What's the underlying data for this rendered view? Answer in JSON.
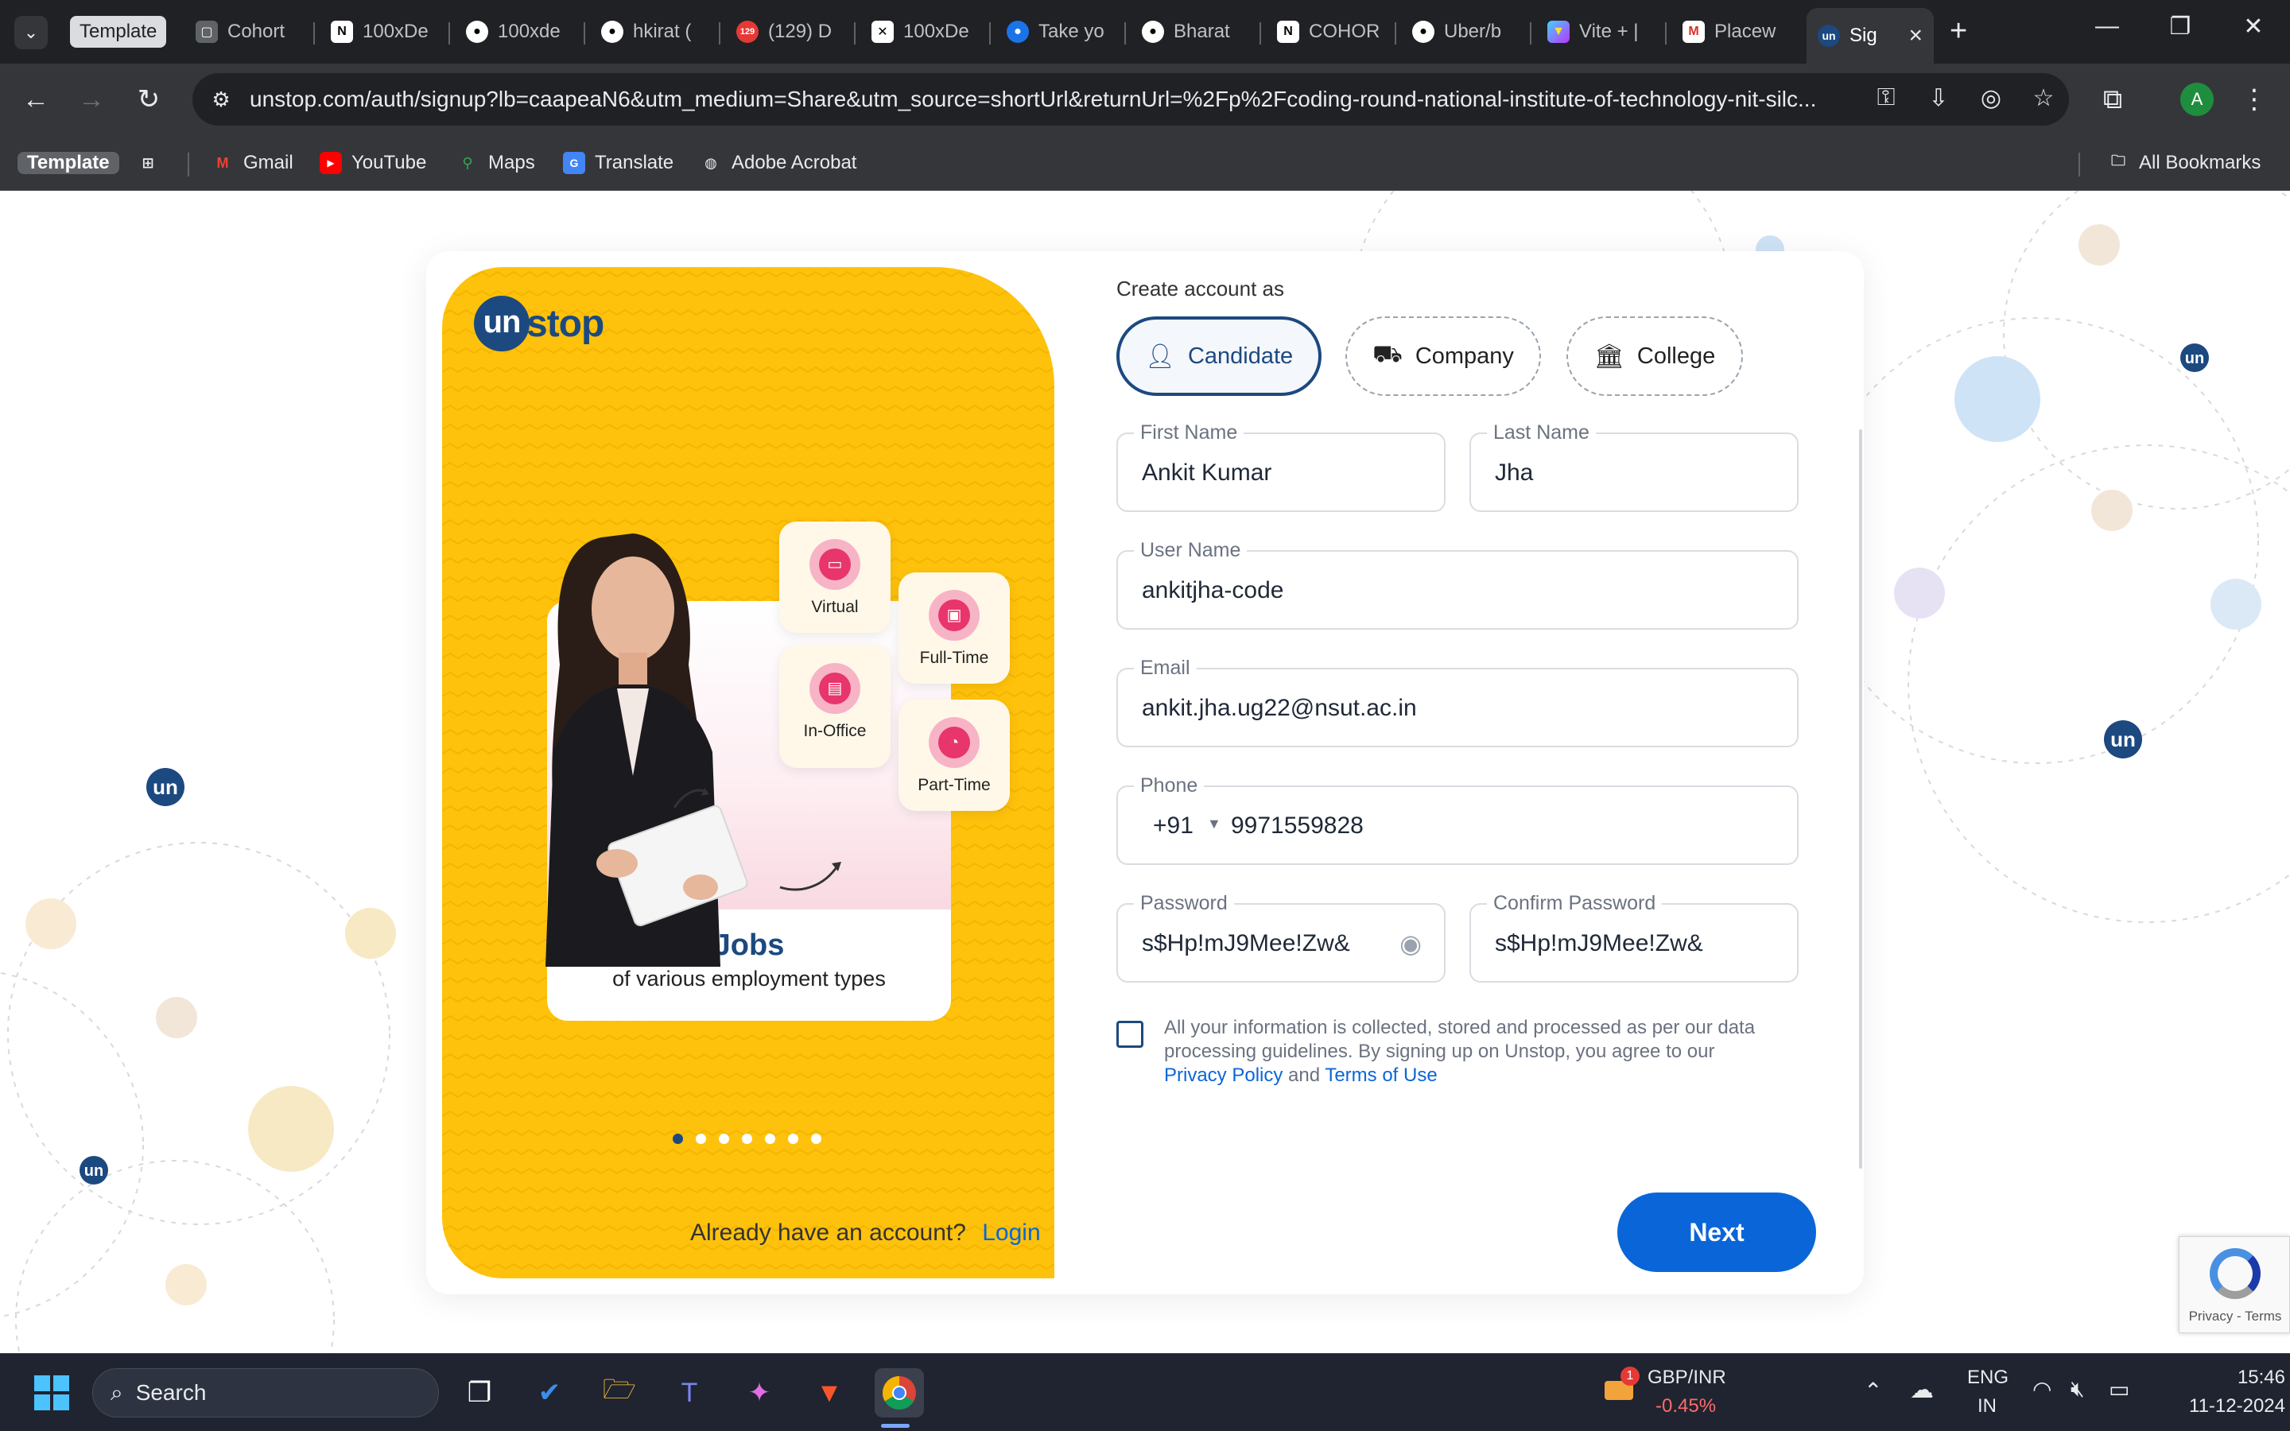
{
  "browser": {
    "tabs": [
      {
        "label": "Template",
        "icon": "tab-group-chip"
      },
      {
        "label": "Cohort",
        "icon": "page-icon"
      },
      {
        "label": "100xDe",
        "icon": "notion-icon"
      },
      {
        "label": "100xde",
        "icon": "github-icon"
      },
      {
        "label": "hkirat (",
        "icon": "github-icon"
      },
      {
        "label": "(129) D",
        "icon": "youtube-badge-icon",
        "badge": "129"
      },
      {
        "label": "100xDe",
        "icon": "x-icon"
      },
      {
        "label": "Take yo",
        "icon": "avatar-icon"
      },
      {
        "label": "Bharat",
        "icon": "github-icon"
      },
      {
        "label": "COHOR",
        "icon": "notion-icon"
      },
      {
        "label": "Uber/b",
        "icon": "github-icon"
      },
      {
        "label": "Vite + |",
        "icon": "vite-icon"
      },
      {
        "label": "Placew",
        "icon": "gmail-icon"
      },
      {
        "label": "Sig",
        "icon": "unstop-icon",
        "active": true
      }
    ],
    "url": "unstop.com/auth/signup?lb=caapeaN6&utm_medium=Share&utm_source=shortUrl&returnUrl=%2Fp%2Fcoding-round-national-institute-of-technology-nit-silc...",
    "profile_initial": "A",
    "bookmarks": [
      {
        "label": "Template",
        "icon": "tab-group-chip"
      },
      {
        "label": "Gmail",
        "icon": "gmail-icon"
      },
      {
        "label": "YouTube",
        "icon": "youtube-icon"
      },
      {
        "label": "Maps",
        "icon": "maps-icon"
      },
      {
        "label": "Translate",
        "icon": "translate-icon"
      },
      {
        "label": "Adobe Acrobat",
        "icon": "acrobat-icon"
      }
    ],
    "all_bookmarks": "All Bookmarks"
  },
  "promo": {
    "logo_mark": "un",
    "logo_text": "stop",
    "job_types": [
      "Virtual",
      "Full-Time",
      "In-Office",
      "Part-Time"
    ],
    "slide_title": "Jobs",
    "slide_subtitle": "of various employment types",
    "slide_count": 7,
    "active_slide": 1
  },
  "form": {
    "create_account_label": "Create account as",
    "roles": [
      {
        "label": "Candidate",
        "icon": "user-icon",
        "selected": true
      },
      {
        "label": "Company",
        "icon": "briefcase-hand-icon",
        "selected": false
      },
      {
        "label": "College",
        "icon": "building-icon",
        "selected": false
      }
    ],
    "first_name": {
      "label": "First Name",
      "value": "Ankit Kumar"
    },
    "last_name": {
      "label": "Last Name",
      "value": "Jha"
    },
    "username": {
      "label": "User Name",
      "value": "ankitjha-code"
    },
    "email": {
      "label": "Email",
      "value": "ankit.jha.ug22@nsut.ac.in"
    },
    "phone": {
      "label": "Phone",
      "country_code": "+91",
      "value": "9971559828"
    },
    "password": {
      "label": "Password",
      "value": "s$Hp!mJ9Mee!Zw&"
    },
    "confirm_password": {
      "label": "Confirm Password",
      "value": "s$Hp!mJ9Mee!Zw&"
    },
    "consent_text": "All your information is collected, stored and processed as per our data processing guidelines. By signing up on Unstop, you agree to our",
    "privacy_link": "Privacy Policy",
    "and_text": "and",
    "terms_link": "Terms of Use",
    "consent_checked": false,
    "have_account": "Already have an account?",
    "login_link": "Login",
    "next_button": "Next"
  },
  "recaptcha": {
    "text": "Privacy - Terms"
  },
  "background": {
    "floating_logo": "un"
  },
  "taskbar": {
    "search_label": "Search",
    "ticker_name": "GBP/INR",
    "ticker_change": "-0.45%",
    "ticker_badge": "1",
    "lang_primary": "ENG",
    "lang_secondary": "IN",
    "time": "15:46",
    "date": "11-12-2024"
  }
}
